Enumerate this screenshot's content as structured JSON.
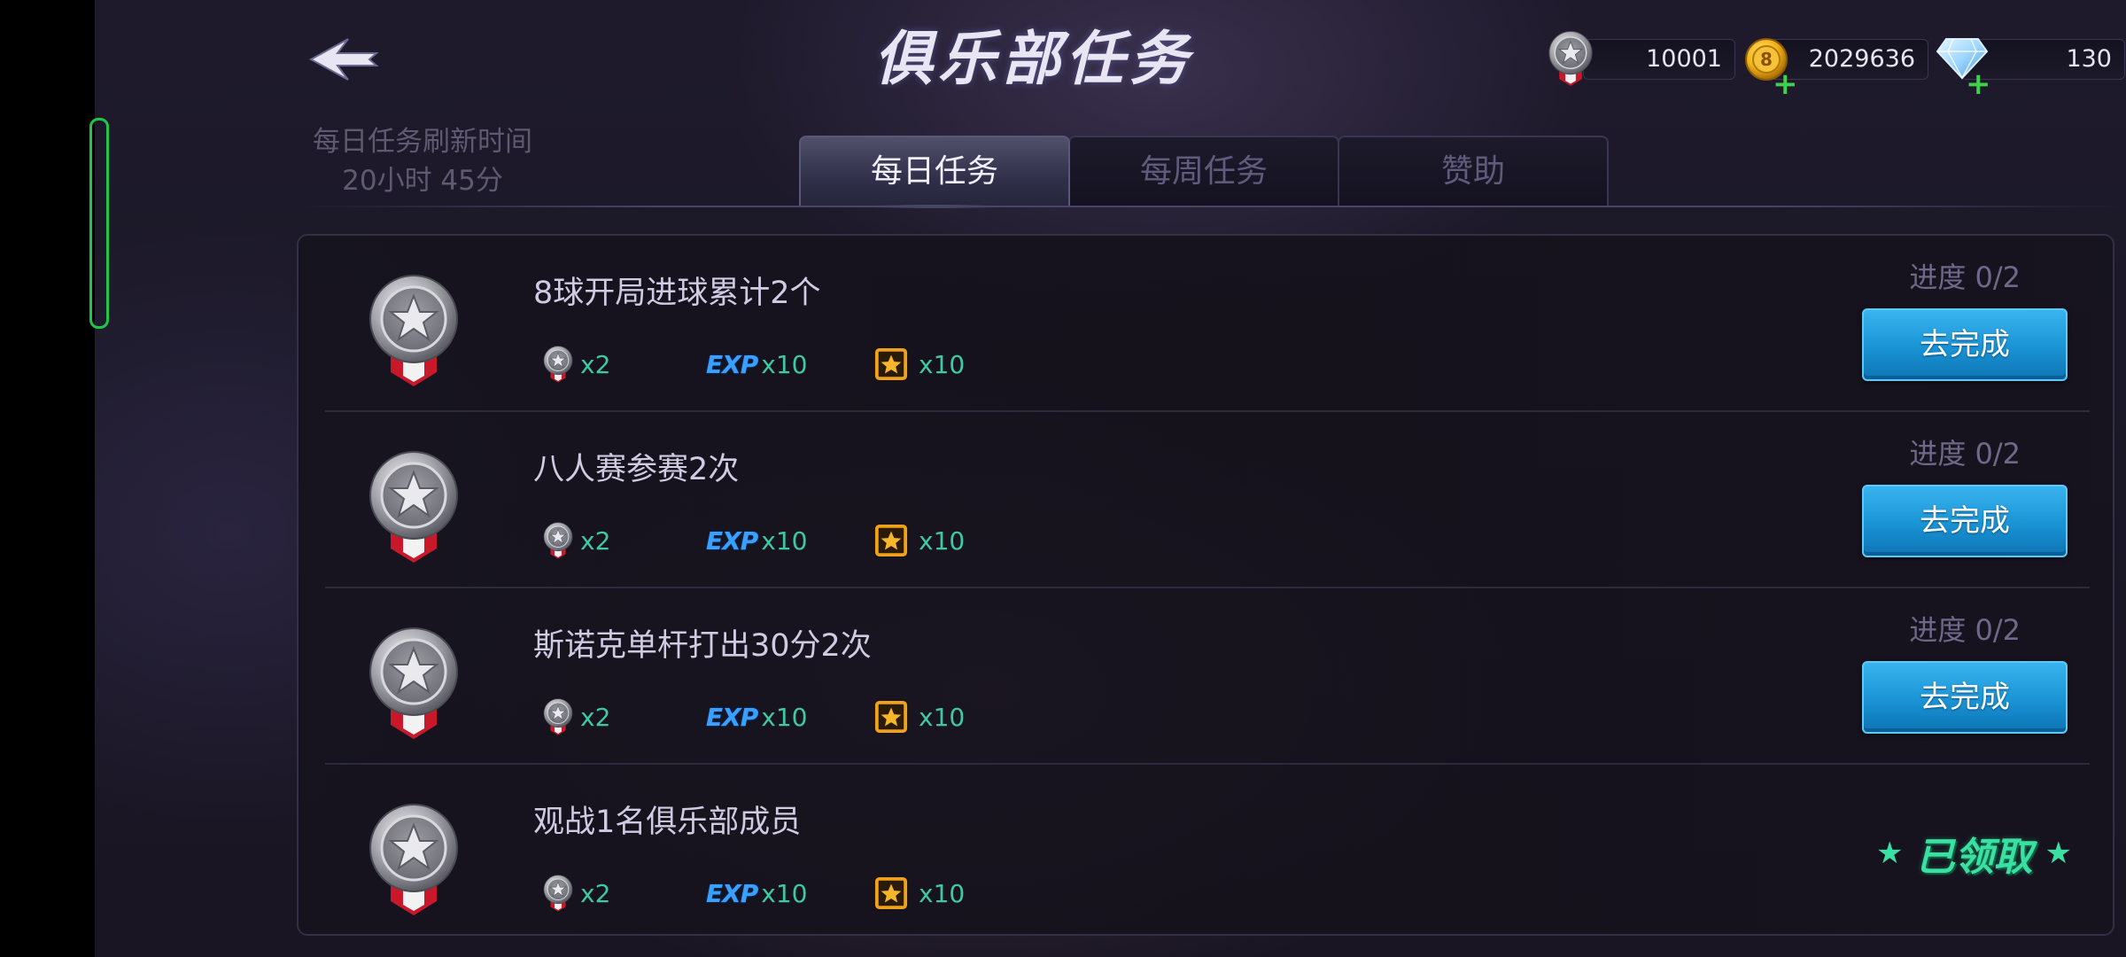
{
  "header": {
    "title": "俱乐部任务",
    "currencies": [
      {
        "name": "medal",
        "value": "10001"
      },
      {
        "name": "coin",
        "value": "2029636"
      },
      {
        "name": "diamond",
        "value": "130"
      }
    ]
  },
  "refresh": {
    "label": "每日任务刷新时间",
    "time": "20小时 45分"
  },
  "tabs": [
    {
      "label": "每日任务",
      "active": true
    },
    {
      "label": "每周任务",
      "active": false
    },
    {
      "label": "赞助",
      "active": false
    }
  ],
  "tasks": [
    {
      "title": "8球开局进球累计2个",
      "rewards": {
        "medal": "x2",
        "exp": "x10",
        "badge": "x10"
      },
      "progress": "进度 0/2",
      "action": "去完成"
    },
    {
      "title": "八人赛参赛2次",
      "rewards": {
        "medal": "x2",
        "exp": "x10",
        "badge": "x10"
      },
      "progress": "进度 0/2",
      "action": "去完成"
    },
    {
      "title": "斯诺克单杆打出30分2次",
      "rewards": {
        "medal": "x2",
        "exp": "x10",
        "badge": "x10"
      },
      "progress": "进度 0/2",
      "action": "去完成"
    },
    {
      "title": "观战1名俱乐部成员",
      "rewards": {
        "medal": "x2",
        "exp": "x10",
        "badge": "x10"
      },
      "status": "已领取"
    }
  ],
  "exp_label": "EXP",
  "colors": {
    "accent_blue": "#1a93d4",
    "reward_green": "#3fc8a4",
    "claimed_green": "#39e0a2"
  }
}
